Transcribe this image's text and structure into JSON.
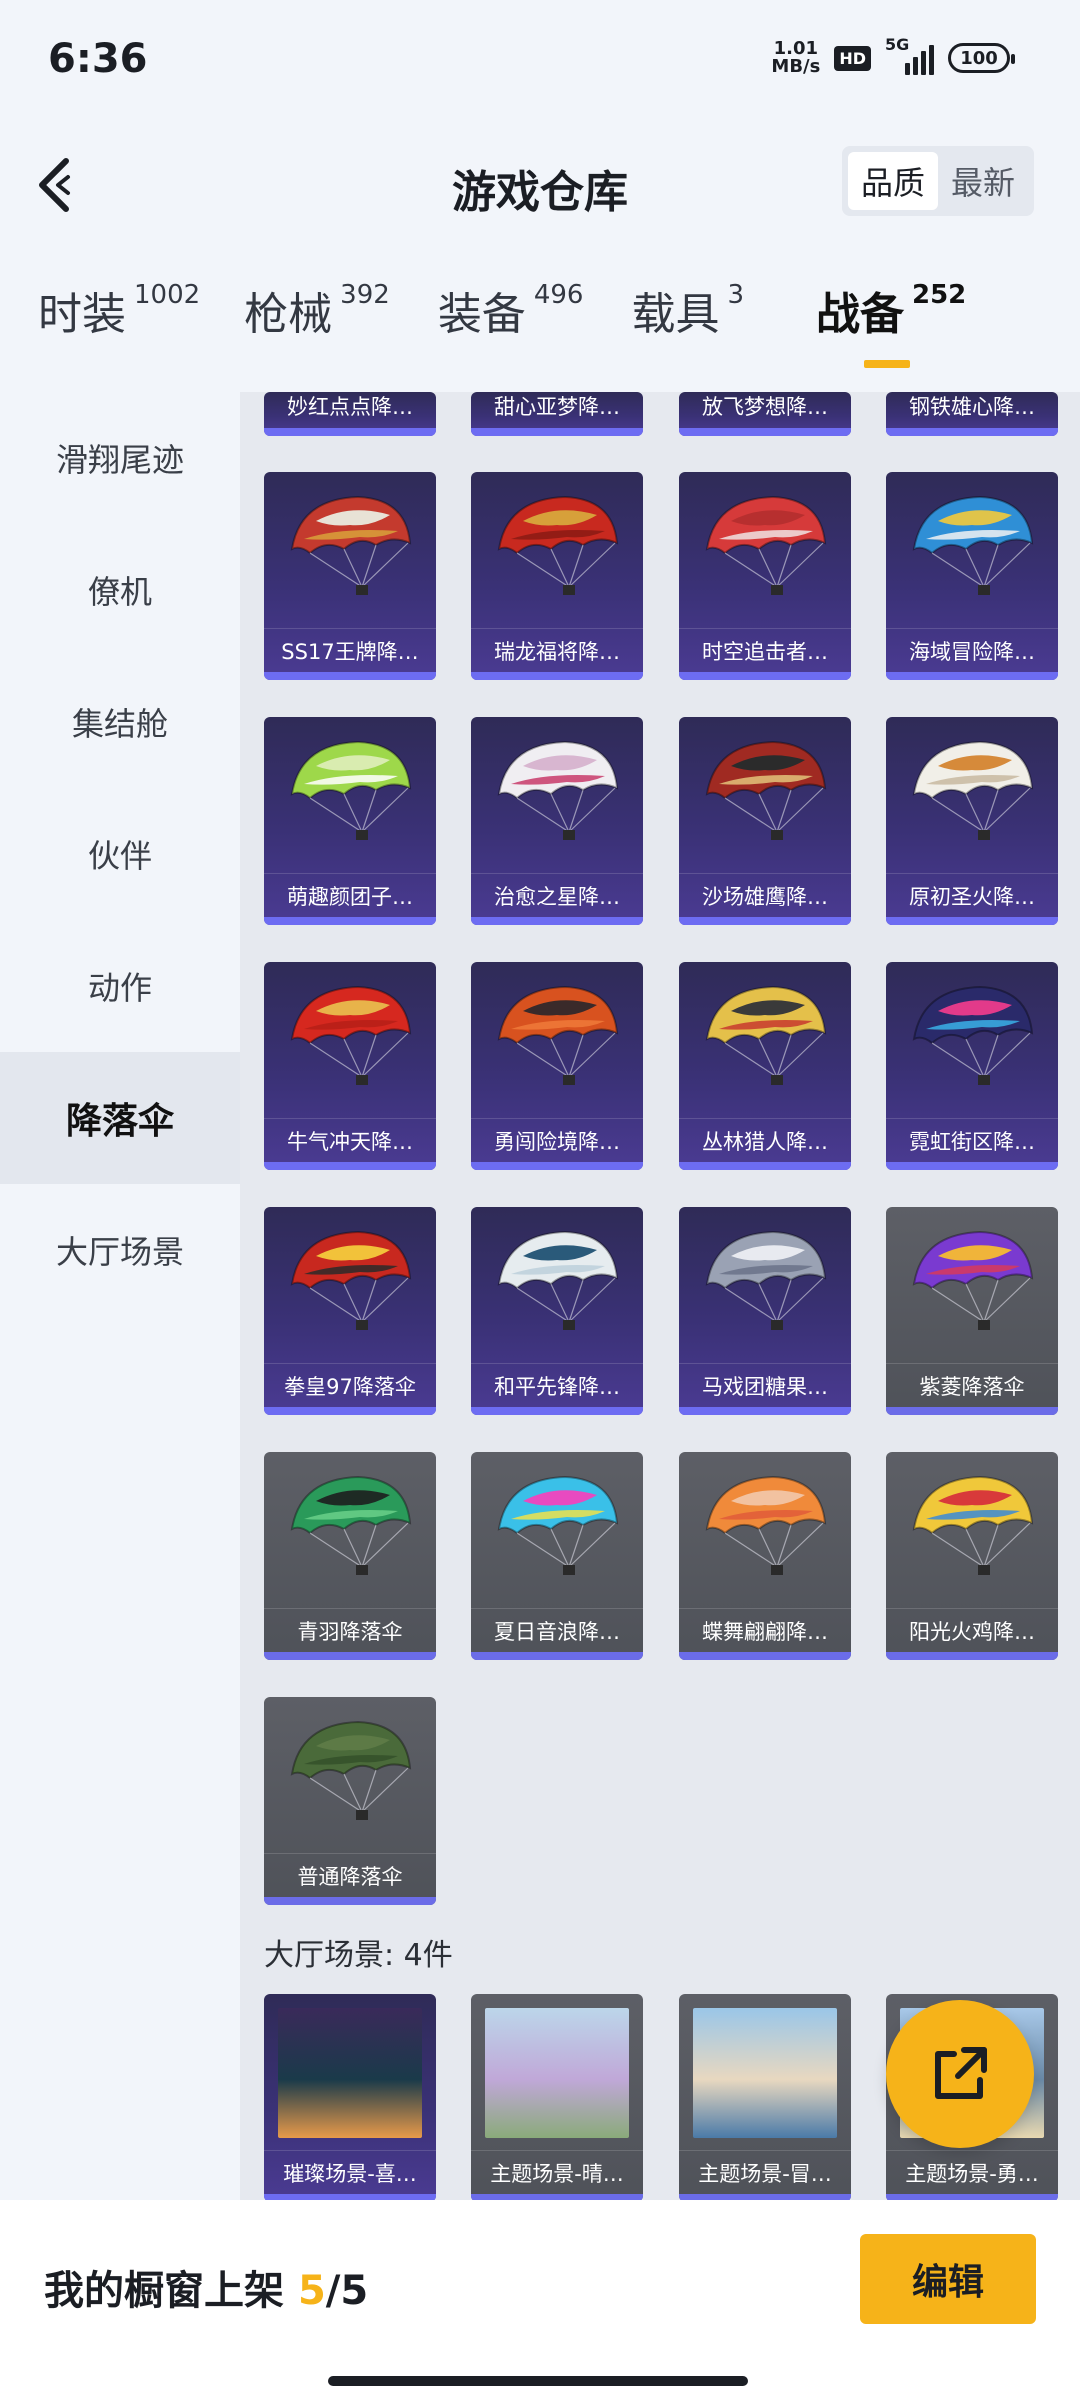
{
  "status_bar": {
    "time": "6:36",
    "net_speed_value": "1.01",
    "net_speed_unit": "MB/s",
    "hd": "HD",
    "network": "5G",
    "battery": "100"
  },
  "header": {
    "title": "游戏仓库",
    "sort_quality": "品质",
    "sort_latest": "最新"
  },
  "tabs": [
    {
      "label": "时装",
      "count": "1002"
    },
    {
      "label": "枪械",
      "count": "392"
    },
    {
      "label": "装备",
      "count": "496"
    },
    {
      "label": "载具",
      "count": "3"
    },
    {
      "label": "战备",
      "count": "252"
    }
  ],
  "sidebar": {
    "items": [
      {
        "label": "滑翔尾迹"
      },
      {
        "label": "僚机"
      },
      {
        "label": "集结舱"
      },
      {
        "label": "伙伴"
      },
      {
        "label": "动作"
      },
      {
        "label": "降落伞"
      },
      {
        "label": "大厅场景"
      }
    ]
  },
  "top_partial_cards": [
    {
      "label": "妙红点点降…"
    },
    {
      "label": "甜心亚梦降…"
    },
    {
      "label": "放飞梦想降…"
    },
    {
      "label": "钢铁雄心降…"
    }
  ],
  "parachute_cards": [
    {
      "label": "SS17王牌降…",
      "colors": [
        "#c43a2e",
        "#e8e2d6",
        "#d9a23a"
      ],
      "style": "purple"
    },
    {
      "label": "瑞龙福将降…",
      "colors": [
        "#c8291f",
        "#d7a03a",
        "#8a1a14"
      ],
      "style": "purple"
    },
    {
      "label": "时空追击者…",
      "colors": [
        "#d63a3a",
        "#b72f2f",
        "#f0e4e4"
      ],
      "style": "purple"
    },
    {
      "label": "海域冒险降…",
      "colors": [
        "#2f8fd6",
        "#e0c44a",
        "#f2f2f2"
      ],
      "style": "purple"
    },
    {
      "label": "萌趣颜团子…",
      "colors": [
        "#9ed84a",
        "#d9ecb0",
        "#ffffff"
      ],
      "style": "purple"
    },
    {
      "label": "治愈之星降…",
      "colors": [
        "#f0eef2",
        "#d8b6d0",
        "#c83a6a"
      ],
      "style": "purple"
    },
    {
      "label": "沙场雄鹰降…",
      "colors": [
        "#a02a22",
        "#2b2b2b",
        "#e3c37a"
      ],
      "style": "purple"
    },
    {
      "label": "原初圣火降…",
      "colors": [
        "#f1efe8",
        "#d68a3a",
        "#c8b8a0"
      ],
      "style": "purple"
    },
    {
      "label": "牛气冲天降…",
      "colors": [
        "#d6281f",
        "#e8b34a",
        "#b61e18"
      ],
      "style": "purple"
    },
    {
      "label": "勇闯险境降…",
      "colors": [
        "#d8521f",
        "#3a2a2a",
        "#f07a3a"
      ],
      "style": "purple"
    },
    {
      "label": "丛林猎人降…",
      "colors": [
        "#e4c04a",
        "#3a3a3a",
        "#c8382e"
      ],
      "style": "purple"
    },
    {
      "label": "霓虹街区降…",
      "colors": [
        "#2a2a6a",
        "#e23a8a",
        "#3ab0e8"
      ],
      "style": "purple"
    },
    {
      "label": "拳皇97降落伞",
      "colors": [
        "#c8281f",
        "#f2c23a",
        "#2a2a2a"
      ],
      "style": "purple"
    },
    {
      "label": "和平先锋降…",
      "colors": [
        "#e6ecef",
        "#2a5a7a",
        "#bcd0da"
      ],
      "style": "purple"
    },
    {
      "label": "马戏团糖果…",
      "colors": [
        "#9aa2b4",
        "#e8eaf0",
        "#6a7288"
      ],
      "style": "purple"
    },
    {
      "label": "紫菱降落伞",
      "colors": [
        "#7a3ad0",
        "#f0b43a",
        "#d83a5a"
      ],
      "style": "gray"
    },
    {
      "label": "青羽降落伞",
      "colors": [
        "#2a9a5a",
        "#1e2a24",
        "#6ad08a"
      ],
      "style": "gray"
    },
    {
      "label": "夏日音浪降…",
      "colors": [
        "#3ac0e8",
        "#e84ac0",
        "#f0e24a"
      ],
      "style": "gray"
    },
    {
      "label": "蝶舞翩翩降…",
      "colors": [
        "#f08a3a",
        "#f2c2a0",
        "#e05a3a"
      ],
      "style": "gray"
    },
    {
      "label": "阳光火鸡降…",
      "colors": [
        "#f0c83a",
        "#d83a3a",
        "#3a8ad8"
      ],
      "style": "gray"
    },
    {
      "label": "普通降落伞",
      "colors": [
        "#4a6a3a",
        "#5d7a46",
        "#34502a"
      ],
      "style": "gray"
    }
  ],
  "lobby_section": {
    "title": "大厅场景: 4件",
    "cards": [
      {
        "label": "璀璨场景-喜…",
        "colors": [
          "#3a2a5a",
          "#e89a4a",
          "#1a3a4a"
        ],
        "style": "purple"
      },
      {
        "label": "主题场景-晴…",
        "colors": [
          "#bcd6ea",
          "#8aaa7a",
          "#c0a8d8"
        ],
        "style": "gray"
      },
      {
        "label": "主题场景-冒…",
        "colors": [
          "#9ac6e8",
          "#4a7aa8",
          "#e8d8c0"
        ],
        "style": "gray"
      },
      {
        "label": "主题场景-勇…",
        "colors": [
          "#a8c8e8",
          "#e8d8b0",
          "#6a8aa8"
        ],
        "style": "gray"
      }
    ]
  },
  "bottom_bar": {
    "showcase_label": "我的橱窗上架",
    "showcase_current": "5",
    "showcase_sep": "/",
    "showcase_total": "5",
    "edit_label": "编辑"
  },
  "colors": {
    "accent": "#f6b319",
    "card_purple": "#3a3176",
    "card_gray": "#55575e",
    "card_stripe": "#6d6cf2"
  }
}
